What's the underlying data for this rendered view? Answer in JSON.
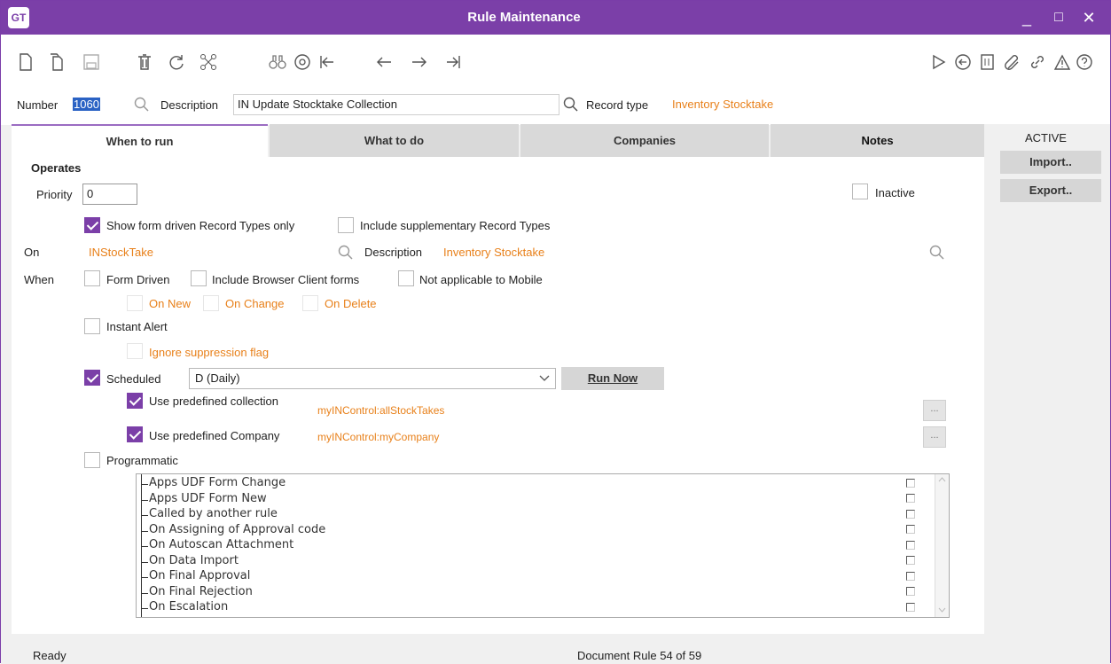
{
  "app": {
    "logo": "GT",
    "title": "Rule Maintenance"
  },
  "window_controls": {
    "minimize": "_",
    "maximize": "□",
    "close": "✕"
  },
  "header": {
    "number_label": "Number",
    "number_value": "1060",
    "description_label": "Description",
    "description_value": "IN Update Stocktake Collection",
    "record_type_label": "Record type",
    "record_type_value": "Inventory Stocktake"
  },
  "tabs": [
    {
      "label": "When to run"
    },
    {
      "label": "What to do"
    },
    {
      "label": "Companies"
    },
    {
      "label": "Notes"
    }
  ],
  "side": {
    "status": "ACTIVE",
    "import_label": "Import..",
    "export_label": "Export.."
  },
  "form": {
    "section_title": "Operates",
    "priority_label": "Priority",
    "priority_value": "0",
    "inactive_label": "Inactive",
    "show_form_driven_label": "Show form driven Record Types only",
    "include_supplementary_label": "Include supplementary Record Types",
    "on_label": "On",
    "on_value": "INStockTake",
    "on_description_label": "Description",
    "on_description_value": "Inventory Stocktake",
    "when_label": "When",
    "form_driven_label": "Form Driven",
    "include_browser_label": "Include Browser Client forms",
    "not_mobile_label": "Not applicable to Mobile",
    "on_new_label": "On New",
    "on_change_label": "On Change",
    "on_delete_label": "On Delete",
    "instant_alert_label": "Instant Alert",
    "ignore_suppression_label": "Ignore suppression flag",
    "scheduled_label": "Scheduled",
    "schedule_value": "D  (Daily)",
    "run_now_label": "Run Now",
    "use_collection_label": "Use predefined collection",
    "collection_value": "myINControl:allStockTakes",
    "use_company_label": "Use predefined Company",
    "company_value": "myINControl:myCompany",
    "dots": "...",
    "programmatic_label": "Programmatic"
  },
  "events": [
    "Apps UDF Form Change",
    "Apps UDF Form New",
    "Called by another rule",
    "On Assigning of Approval code",
    "On Autoscan Attachment",
    "On Data Import",
    "On Final Approval",
    "On Final Rejection",
    "On Escalation"
  ],
  "status": {
    "left": "Ready",
    "center": "Document Rule 54 of 59"
  },
  "colors": {
    "accent": "#7b3fa8",
    "orange": "#e8801a"
  }
}
